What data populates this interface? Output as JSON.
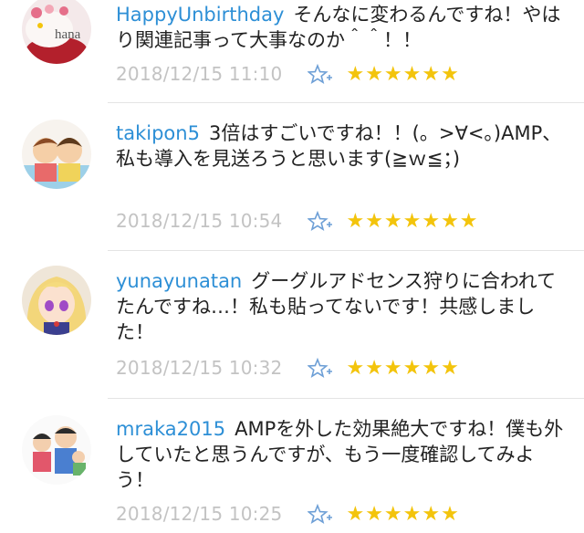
{
  "comments": [
    {
      "author": "HappyUnbirthday",
      "text": "そんなに変わるんですね！やはり関連記事って大事なのか＾＾！！",
      "date": "2018/12/15 11:10",
      "stars": "★★★★★★",
      "avatar_label": "hana"
    },
    {
      "author": "takipon5",
      "text": "3倍はすごいですね！！(。>∀<。)AMP、私も導入を見送ろうと思います(≧ｗ≦；)",
      "date": "2018/12/15 10:54",
      "stars": "★★★★★★★"
    },
    {
      "author": "yunayunatan",
      "text": "グーグルアドセンス狩りに合われてたんですね…！私も貼ってないです！共感しました！",
      "date": "2018/12/15 10:32",
      "stars": "★★★★★★"
    },
    {
      "author": "mraka2015",
      "text": "AMPを外した効果絶大ですね！僕も外していたと思うんですが、もう一度確認してみよう！",
      "date": "2018/12/15 10:25",
      "stars": "★★★★★★"
    }
  ],
  "colors": {
    "author": "#2d8fd6",
    "star": "#f3c40c",
    "date": "#c3c3c3",
    "divider": "#e4e4e4"
  }
}
